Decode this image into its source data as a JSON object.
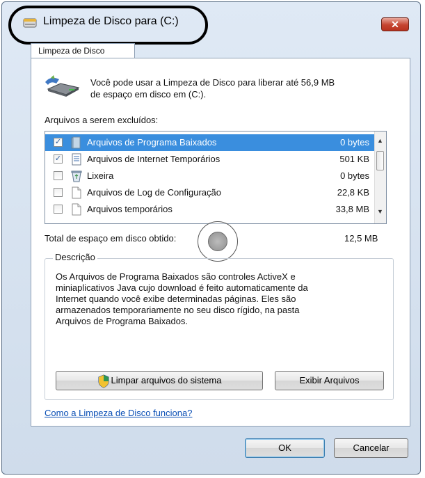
{
  "window": {
    "title": "Limpeza de Disco para  (C:)",
    "close_label": "x"
  },
  "tab": {
    "label": "Limpeza de Disco"
  },
  "intro": {
    "line1": "Você pode usar a Limpeza de Disco para liberar até 56,9 MB",
    "line2": "de espaço em disco em  (C:)."
  },
  "files": {
    "label": "Arquivos a serem excluídos:",
    "items": [
      {
        "name": "Arquivos de Programa Baixados",
        "size": "0 bytes",
        "checked": true,
        "selected": true,
        "icon": "folder-icon"
      },
      {
        "name": "Arquivos de Internet Temporários",
        "size": "501 KB",
        "checked": true,
        "selected": false,
        "icon": "document-icon"
      },
      {
        "name": "Lixeira",
        "size": "0 bytes",
        "checked": false,
        "selected": false,
        "icon": "recycle-bin-icon"
      },
      {
        "name": "Arquivos de Log de Configuração",
        "size": "22,8 KB",
        "checked": false,
        "selected": false,
        "icon": "file-icon"
      },
      {
        "name": "Arquivos temporários",
        "size": "33,8 MB",
        "checked": false,
        "selected": false,
        "icon": "file-icon"
      }
    ]
  },
  "total": {
    "label": "Total de espaço em disco obtido:",
    "value": "12,5 MB"
  },
  "description": {
    "title": "Descrição",
    "lines": [
      "Os Arquivos de Programa Baixados são controles ActiveX e",
      "miniaplicativos Java cujo download é feito automaticamente da",
      "Internet quando você exibe determinadas páginas. Eles são",
      "armazenados temporariamente no seu disco rígido, na pasta",
      "Arquivos de Programa Baixados."
    ]
  },
  "buttons": {
    "clean_system": "Limpar arquivos do sistema",
    "view_files": "Exibir Arquivos",
    "ok": "OK",
    "cancel": "Cancelar"
  },
  "help_link": "Como a Limpeza de Disco funciona?",
  "colors": {
    "selection": "#3a8ede",
    "link": "#0a4fb5",
    "close": "#c5432f"
  }
}
